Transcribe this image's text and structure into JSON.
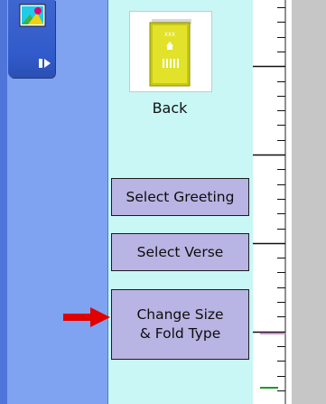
{
  "thumbnail": {
    "label": "Back"
  },
  "buttons": {
    "select_greeting": "Select Greeting",
    "select_verse": "Select Verse",
    "change_size_line1": "Change Size",
    "change_size_line2": "& Fold Type"
  },
  "colors": {
    "left_panel": "#7fa3f0",
    "middle_panel": "#c8f7f5",
    "button_fill": "#b8b4e3",
    "arrow": "#e00000"
  },
  "icons": {
    "toolbar_tool": "picture-icon",
    "toolbar_expand": "expand-arrow-icon",
    "pointer": "red-arrow-icon"
  }
}
